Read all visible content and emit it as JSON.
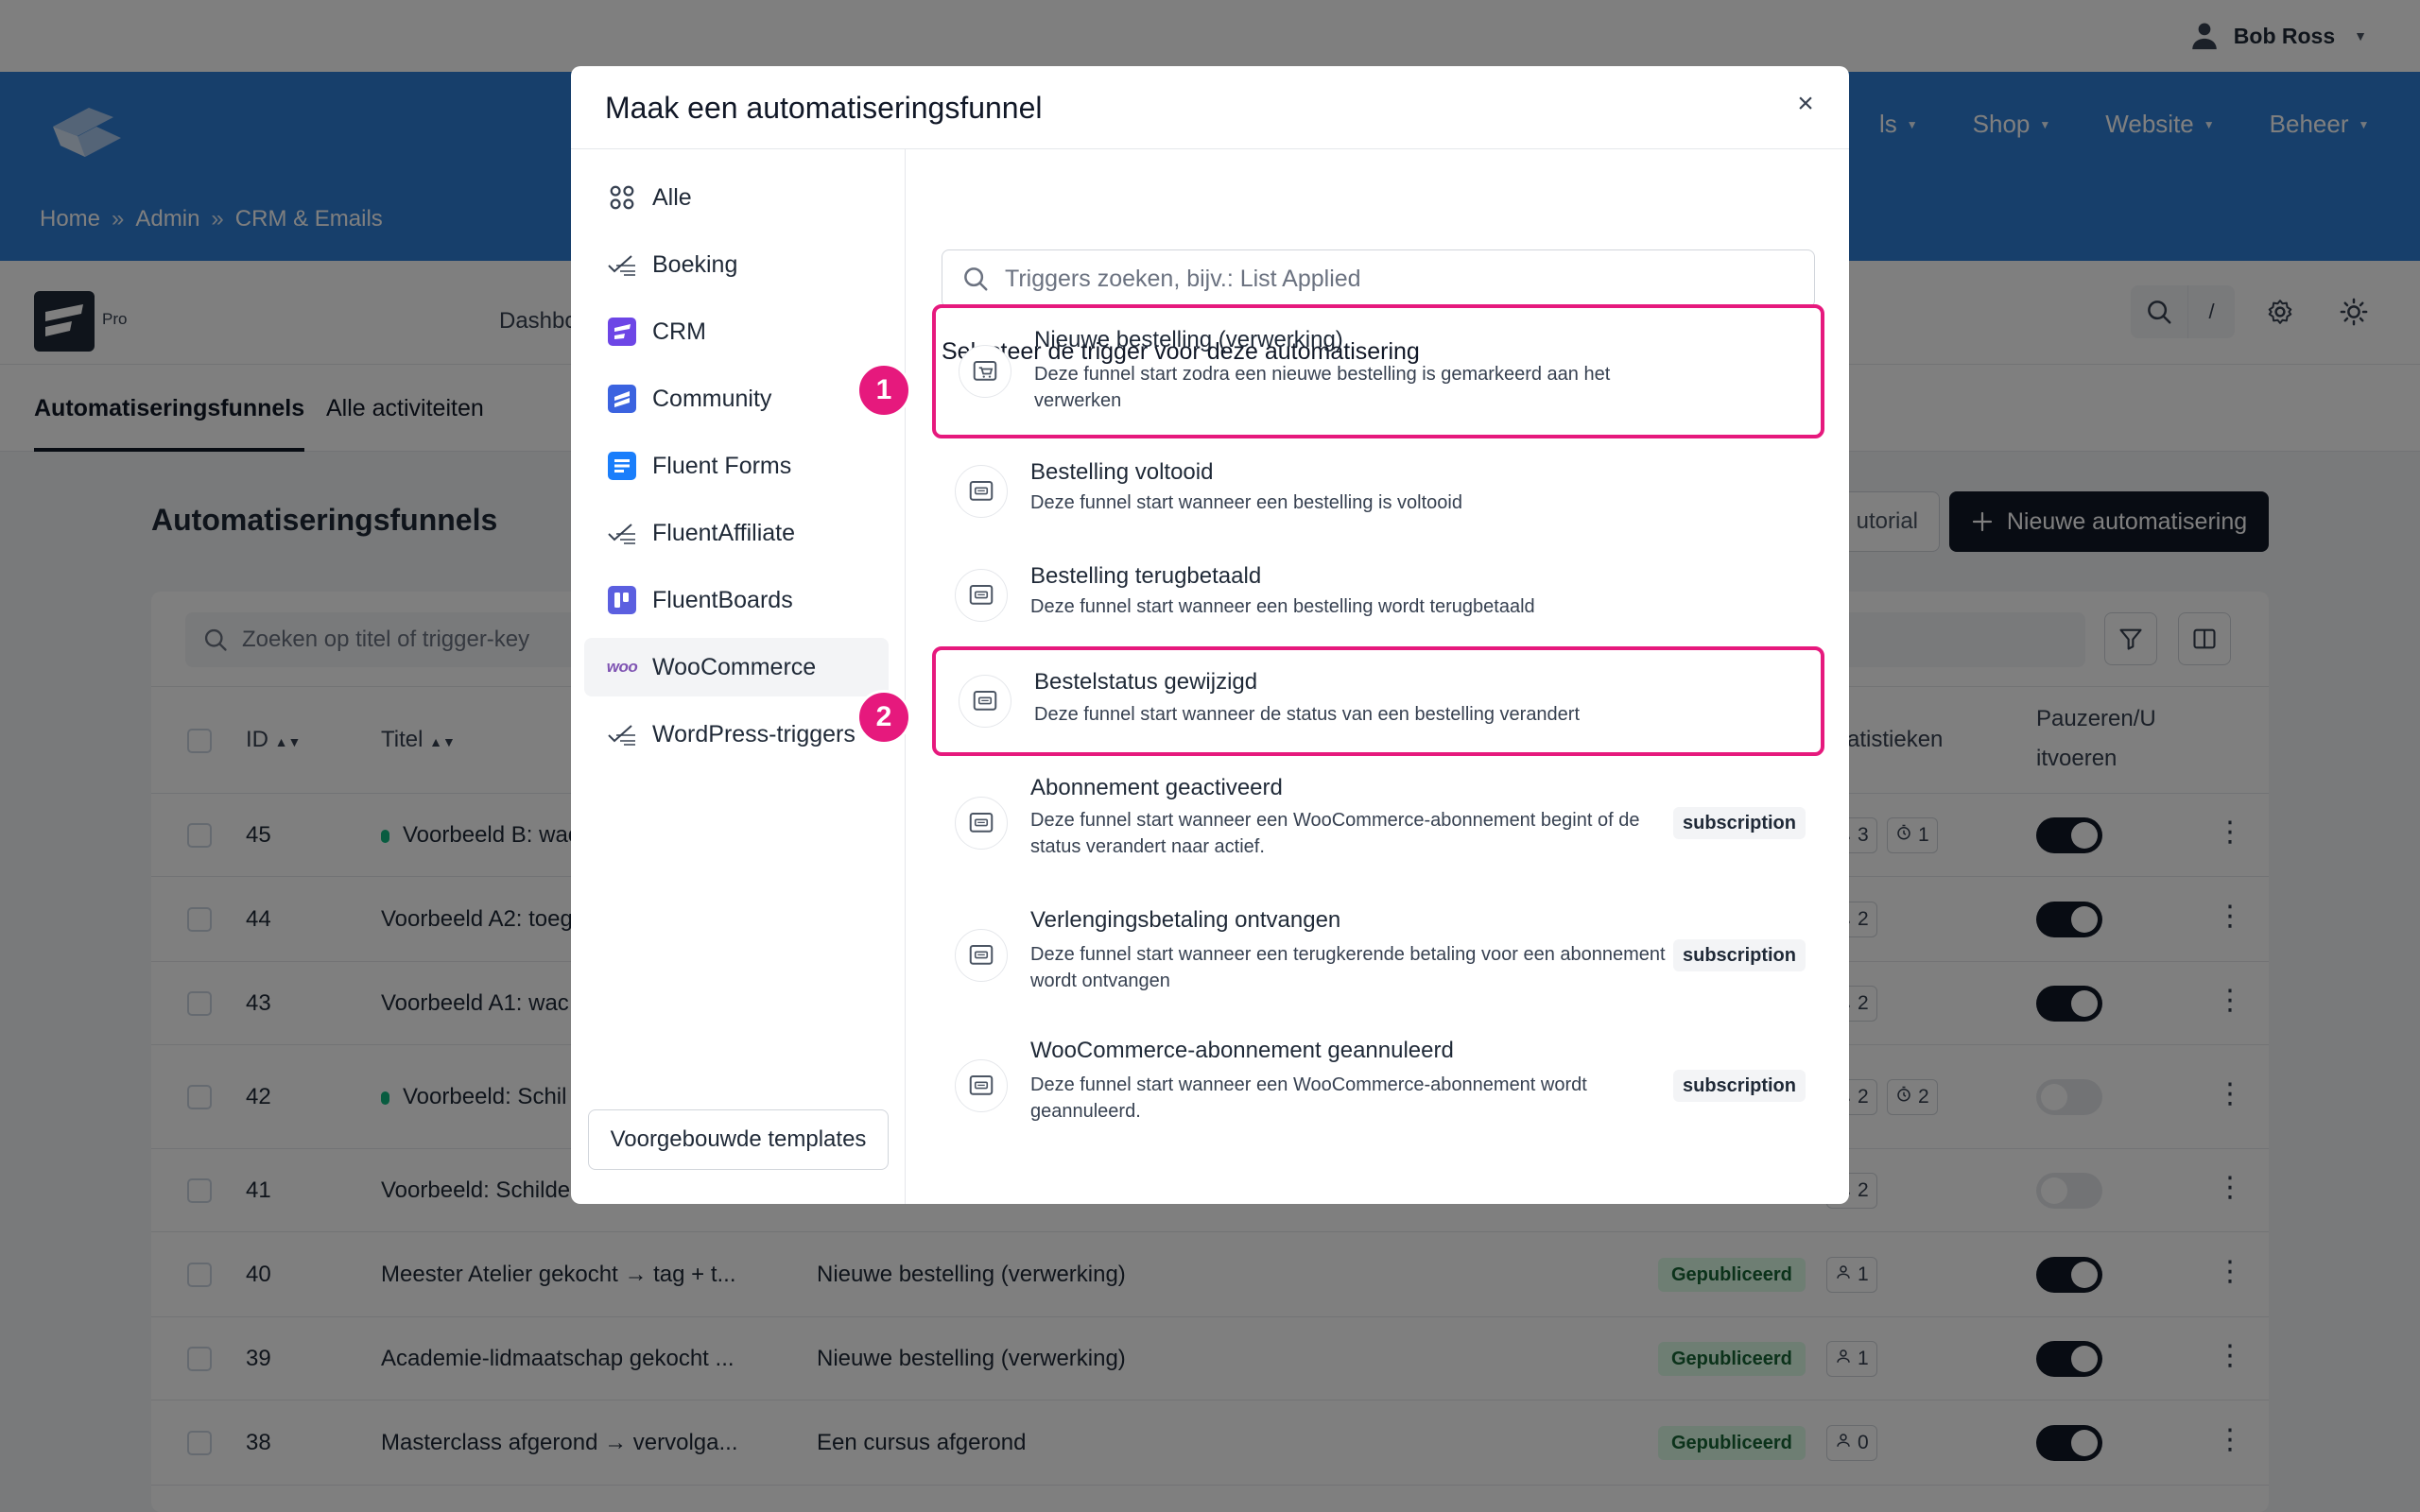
{
  "user": {
    "name": "Bob Ross"
  },
  "nav": {
    "items": [
      "ls",
      "Shop",
      "Website",
      "Beheer"
    ]
  },
  "breadcrumb": {
    "home": "Home",
    "sep": "»",
    "admin": "Admin",
    "current": "CRM & Emails"
  },
  "brand": {
    "pro": "Pro",
    "dashboard": "Dashbo"
  },
  "header_tools": {
    "slash": "/"
  },
  "tabs": {
    "funnels": "Automatiseringsfunnels",
    "activities": "Alle activiteiten"
  },
  "page": {
    "title": "Automatiseringsfunnels",
    "tutorial": "utorial",
    "new_button": "Nieuwe automatisering",
    "search_placeholder": "Zoeken op titel of trigger-key"
  },
  "table": {
    "headers": {
      "id": "ID",
      "title": "Titel",
      "stats": "atistieken",
      "pause": "Pauzeren/U",
      "pause2": "itvoeren"
    },
    "rows": [
      {
        "id": "45",
        "title": "Voorbeeld B: wac",
        "trigger": "",
        "status": "",
        "s1": "3",
        "s2": "1",
        "dot": true,
        "on": true
      },
      {
        "id": "44",
        "title": "Voorbeeld A2: toeg",
        "trigger": "",
        "status": "",
        "s1": "2",
        "s2": "",
        "dot": false,
        "on": true
      },
      {
        "id": "43",
        "title": "Voorbeeld A1: wac",
        "trigger": "",
        "status": "",
        "s1": "2",
        "s2": "",
        "dot": false,
        "on": true
      },
      {
        "id": "42",
        "title": "Voorbeeld: Schil",
        "trigger": "",
        "status": "",
        "s1": "2",
        "s2": "2",
        "dot": true,
        "on": false
      },
      {
        "id": "41",
        "title": "Voorbeeld: Schilde",
        "trigger": "",
        "status": "",
        "s1": "2",
        "s2": "",
        "dot": false,
        "on": false
      },
      {
        "id": "40",
        "title": "Meester Atelier gekocht → tag + t...",
        "trigger": "Nieuwe bestelling (verwerking)",
        "status": "Gepubliceerd",
        "s1": "1",
        "s2": "",
        "dot": false,
        "on": true
      },
      {
        "id": "39",
        "title": "Academie-lidmaatschap gekocht ...",
        "trigger": "Nieuwe bestelling (verwerking)",
        "status": "Gepubliceerd",
        "s1": "1",
        "s2": "",
        "dot": false,
        "on": true
      },
      {
        "id": "38",
        "title": "Masterclass afgerond → vervolga...",
        "trigger": "Een cursus afgerond",
        "status": "Gepubliceerd",
        "s1": "0",
        "s2": "",
        "dot": false,
        "on": true
      }
    ]
  },
  "modal": {
    "title": "Maak een automatiseringsfunnel",
    "close": "×",
    "search_placeholder": "Triggers zoeken, bijv.: List Applied",
    "subtitle": "Selecteer de trigger voor deze automatisering",
    "templates_button": "Voorgebouwde templates",
    "categories": [
      {
        "label": "Alle",
        "icon": "grid-icon"
      },
      {
        "label": "Boeking",
        "icon": "trend-icon"
      },
      {
        "label": "CRM",
        "icon": "fluentcrm-icon"
      },
      {
        "label": "Community",
        "icon": "community-icon"
      },
      {
        "label": "Fluent Forms",
        "icon": "fluent-forms-icon"
      },
      {
        "label": "FluentAffiliate",
        "icon": "trend-icon"
      },
      {
        "label": "FluentBoards",
        "icon": "boards-icon"
      },
      {
        "label": "WooCommerce",
        "icon": "woo-icon",
        "woo": "woo"
      },
      {
        "label": "WordPress-triggers",
        "icon": "trend-icon"
      }
    ],
    "triggers": [
      {
        "name": "Nieuwe bestelling (verwerking)",
        "desc": "Deze funnel start zodra een nieuwe bestelling is gemarkeerd aan het verwerken",
        "tag": ""
      },
      {
        "name": "Bestelling voltooid",
        "desc": "Deze funnel start wanneer een bestelling is voltooid",
        "tag": ""
      },
      {
        "name": "Bestelling terugbetaald",
        "desc": "Deze funnel start wanneer een bestelling wordt terugbetaald",
        "tag": ""
      },
      {
        "name": "Bestelstatus gewijzigd",
        "desc": "Deze funnel start wanneer de status van een bestelling verandert",
        "tag": ""
      },
      {
        "name": "Abonnement geactiveerd",
        "desc": "Deze funnel start wanneer een WooCommerce-abonnement begint of de status verandert naar actief.",
        "tag": "subscription"
      },
      {
        "name": "Verlengingsbetaling ontvangen",
        "desc": "Deze funnel start wanneer een terugkerende betaling voor een abonnement wordt ontvangen",
        "tag": "subscription"
      },
      {
        "name": "WooCommerce-abonnement geannuleerd",
        "desc": "Deze funnel start wanneer een WooCommerce-abonnement wordt geannuleerd.",
        "tag": "subscription"
      }
    ],
    "steps": [
      "1",
      "2"
    ]
  },
  "colors": {
    "brand_blue": "#2f7fd7",
    "highlight": "#e6197d",
    "dark": "#111827"
  }
}
